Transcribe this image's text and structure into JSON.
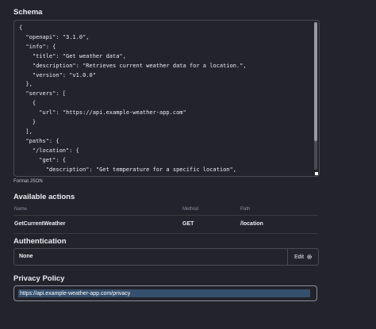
{
  "schema": {
    "title": "Schema",
    "code": "{\n  \"openapi\": \"3.1.0\",\n  \"info\": {\n    \"title\": \"Get weather data\",\n    \"description\": \"Retrieves current weather data for a location.\",\n    \"version\": \"v1.0.0\"\n  },\n  \"servers\": [\n    {\n      \"url\": \"https://api.example-weather-app.com\"\n    }\n  ],\n  \"paths\": {\n    \"/location\": {\n      \"get\": {\n        \"description\": \"Get temperature for a specific location\",\n        \"operationId\": \"GetCurrentWeather\",\n        \"parameters\": [\n          {",
    "format_link": "Format JSON"
  },
  "actions": {
    "title": "Available actions",
    "headers": {
      "name": "Name",
      "method": "Method",
      "path": "Path"
    },
    "rows": [
      {
        "name": "GetCurrentWeather",
        "method": "GET",
        "path": "/location"
      }
    ]
  },
  "authentication": {
    "title": "Authentication",
    "value": "None",
    "edit_label": "Edit",
    "edit_icon": "gear-icon"
  },
  "privacy": {
    "title": "Privacy Policy",
    "url": "https://api.example-weather-app.com/privacy"
  },
  "colors": {
    "background": "#23232b",
    "border": "#4a4a55",
    "text": "#ececf1",
    "muted": "#8e8ea0",
    "selection": "#35506e"
  }
}
